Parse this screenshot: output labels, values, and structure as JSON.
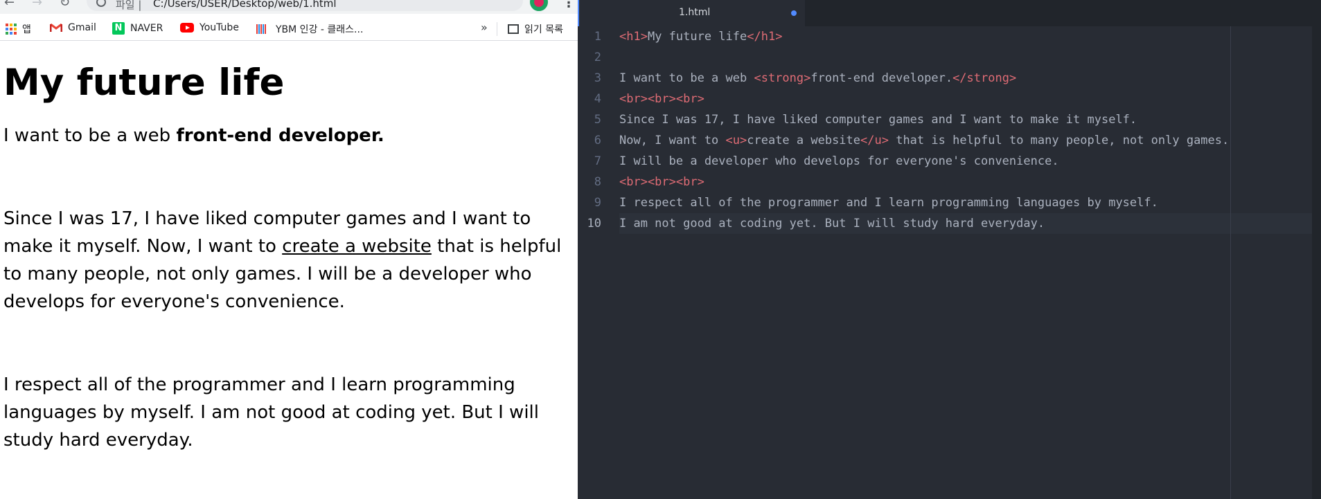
{
  "browser": {
    "address_scheme": "파일 |",
    "address_url": "C:/Users/USER/Desktop/web/1.html",
    "bookmarks": [
      {
        "label": "앱",
        "icon": "apps-grid-icon"
      },
      {
        "label": "Gmail",
        "icon": "gmail-icon"
      },
      {
        "label": "NAVER",
        "icon": "naver-icon"
      },
      {
        "label": "YouTube",
        "icon": "youtube-icon"
      },
      {
        "label": "YBM 인강 - 클래스...",
        "icon": "ybm-icon"
      }
    ],
    "more_bookmarks": "»",
    "reading_list": "읽기 목록",
    "page": {
      "title": "My future life",
      "p1_prefix": "I want to be a web ",
      "p1_strong": "front-end developer.",
      "p2_part1": "Since I was 17, I have liked computer games and I want to make it myself. Now, I want to ",
      "p2_underline": "create a website",
      "p2_part2": " that is helpful to many people, not only games. I will be a developer who develops for everyone's convenience.",
      "p3": "I respect all of the programmer and I learn programming languages by myself. I am not good at coding yet. But I will study hard everyday."
    }
  },
  "editor": {
    "tab_label": "1.html",
    "line_numbers": [
      "1",
      "2",
      "3",
      "4",
      "5",
      "6",
      "7",
      "8",
      "9",
      "10"
    ],
    "lines": {
      "l1_open": "<h1>",
      "l1_text": "My future life",
      "l1_close": "</h1>",
      "l3_text": "I want to be a web ",
      "l3_open": "<strong>",
      "l3_inner": "front-end developer.",
      "l3_close": "</strong>",
      "l4": "<br><br><br>",
      "l5": "Since I was 17, I have liked computer games and I want to make it myself.",
      "l6_a": "Now, I want to ",
      "l6_open": "<u>",
      "l6_inner": "create a website",
      "l6_close": "</u>",
      "l6_b": " that is helpful to many people, not only games.",
      "l7": "I will be a developer who develops for everyone's convenience.",
      "l8": "<br><br><br>",
      "l9": "I respect all of the programmer and I learn programming languages by myself.",
      "l10": "I am not good at coding yet. But I will study hard everyday."
    }
  },
  "colors": {
    "editor_bg": "#282c34",
    "tag": "#e06c75",
    "text": "#abb2bf",
    "accent": "#528bff"
  }
}
